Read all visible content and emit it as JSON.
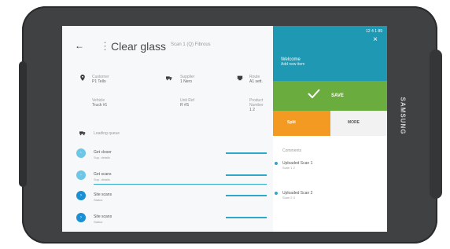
{
  "header": {
    "title": "Clear glass",
    "subtitle": "Scan 1 (Q) Fibrous"
  },
  "fields": {
    "row1": [
      {
        "label": "Customer",
        "value": "P1 Tello"
      },
      {
        "label": "Supplier",
        "value": "1 Nero"
      },
      {
        "label": "Route",
        "value": "A1 sett."
      }
    ],
    "row2": [
      {
        "label": "Vehicle",
        "value": "Truck #1"
      },
      {
        "label": "Unit Ref",
        "value": "R #S"
      },
      {
        "label": "Product Number",
        "value": "1 2"
      }
    ]
  },
  "list": {
    "group_label": "Loading queue",
    "items": [
      {
        "label": "Get closer",
        "sub": "Sup. details"
      },
      {
        "label": "Get scans",
        "sub": "Sup. details"
      },
      {
        "label": "Site scans",
        "sub": "Status"
      },
      {
        "label": "Site scans",
        "sub": "Status"
      }
    ]
  },
  "right_panel": {
    "status": "12 4 1 89",
    "welcome_line1": "Welcome",
    "welcome_line2": "Add new item",
    "save_label": "SAVE",
    "split_label": "Split",
    "more_label": "MORE",
    "section_title": "Comments",
    "entries": [
      {
        "title": "Uploaded Scan 1",
        "sub": "Scan 1 2"
      },
      {
        "title": "Uploaded Scan 2",
        "sub": "Scan 2 4"
      }
    ]
  },
  "brand": "SAMSUNG"
}
